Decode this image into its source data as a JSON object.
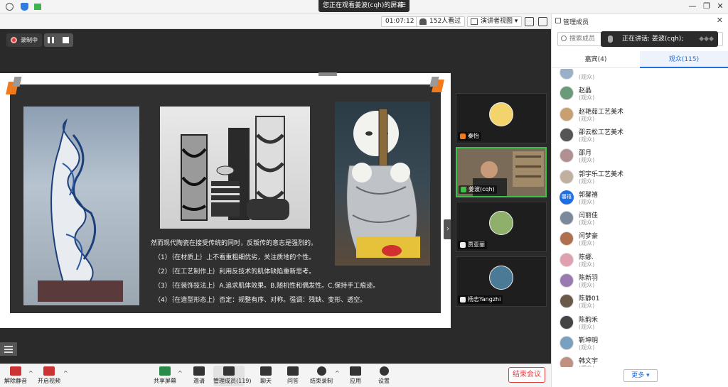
{
  "topbar": {
    "sharing_banner": "您正在观看姜波(cqh)的屏幕",
    "window_controls": [
      "minimize-icon",
      "restore-icon",
      "close-icon"
    ]
  },
  "statusbar": {
    "timer": "01:07:12",
    "viewers": "152人看过",
    "view_mode": "演讲者视图"
  },
  "recording": {
    "label": "录制中"
  },
  "slide": {
    "lead": "然而现代陶瓷在接受传统的同时，反叛传的意志是强烈的。",
    "points": [
      "（1）｛在材质上｝上不看重粗细优劣，关注质地的个性。",
      "（2）｛在工艺制作上｝利用反技术的肌体缺陷重新思考。",
      "（3）｛在装饰技法上｝A.追求肌体效果。B.随机性和偶发性。C.保持手工痕迹。",
      "（4）｛在造型形态上｝否定：规整有序、对称。强调：残缺、变形、透空。"
    ]
  },
  "video_tiles": [
    {
      "name": "秦怡",
      "mic": "host",
      "avatar_color": "#f3d36b"
    },
    {
      "name": "姜波(cqh)",
      "mic": "on",
      "avatar_color": "#8a6a4a"
    },
    {
      "name": "贾亚丽",
      "mic": "off",
      "avatar_color": "#8fb06a"
    },
    {
      "name": "杨志Yangzhi",
      "mic": "off",
      "avatar_color": "#4a7a96"
    }
  ],
  "panel": {
    "title": "管理成员",
    "search_placeholder": "搜索成员",
    "speaking": "正在讲话: 姜波(cqh);",
    "tabs": [
      "嘉宾(4)",
      "观众(115)"
    ],
    "members": [
      {
        "name": "",
        "role": "(观众)",
        "avatar": "#9ab0c8"
      },
      {
        "name": "赵晶",
        "role": "(观众)",
        "avatar": "#6a9a7a"
      },
      {
        "name": "赵艳茹工艺美术",
        "role": "(观众)",
        "avatar": "#c8a070"
      },
      {
        "name": "邵云松工艺美术",
        "role": "(观众)",
        "avatar": "#555555"
      },
      {
        "name": "邵月",
        "role": "(观众)",
        "avatar": "#b09090"
      },
      {
        "name": "郭宇乐工艺美术",
        "role": "(观众)",
        "avatar": "#c0b0a0"
      },
      {
        "name": "郭馨禧",
        "role": "(观众)",
        "avatar_text": "馨禧"
      },
      {
        "name": "闫丽佳",
        "role": "(观众)",
        "avatar": "#7a8a9a"
      },
      {
        "name": "闫梦豪",
        "role": "(观众)",
        "avatar": "#b07050"
      },
      {
        "name": "陈娜.",
        "role": "(观众)",
        "avatar": "#e0a0b0"
      },
      {
        "name": "陈新羽",
        "role": "(观众)",
        "avatar": "#9a7ab0"
      },
      {
        "name": "陈静01",
        "role": "(观众)",
        "avatar": "#6a5a4a"
      },
      {
        "name": "陈韵禾",
        "role": "(观众)",
        "avatar": "#444444"
      },
      {
        "name": "靳坤明",
        "role": "(观众)",
        "avatar": "#7aa0c0"
      },
      {
        "name": "韩文宇",
        "role": "(观众)",
        "avatar": "#c09080"
      }
    ],
    "more_label": "更多 ▾"
  },
  "toolbar": {
    "items": [
      {
        "label": "解除静音",
        "icon": "mic-muted-icon"
      },
      {
        "label": "开启视频",
        "icon": "video-off-icon"
      },
      {
        "label": "共享屏幕",
        "icon": "share-screen-icon"
      },
      {
        "label": "邀请",
        "icon": "invite-icon"
      },
      {
        "label": "管理成员(119)",
        "icon": "members-icon"
      },
      {
        "label": "聊天",
        "icon": "chat-icon"
      },
      {
        "label": "问答",
        "icon": "qa-icon"
      },
      {
        "label": "结束录制",
        "icon": "stop-record-icon"
      },
      {
        "label": "应用",
        "icon": "apps-icon"
      },
      {
        "label": "设置",
        "icon": "settings-icon"
      }
    ],
    "end_meeting": "结束会议"
  },
  "colors": {
    "accent": "#1f6fe0",
    "danger": "#e04040",
    "speaker_border": "#3cc24a",
    "slide_bg": "#303030"
  }
}
